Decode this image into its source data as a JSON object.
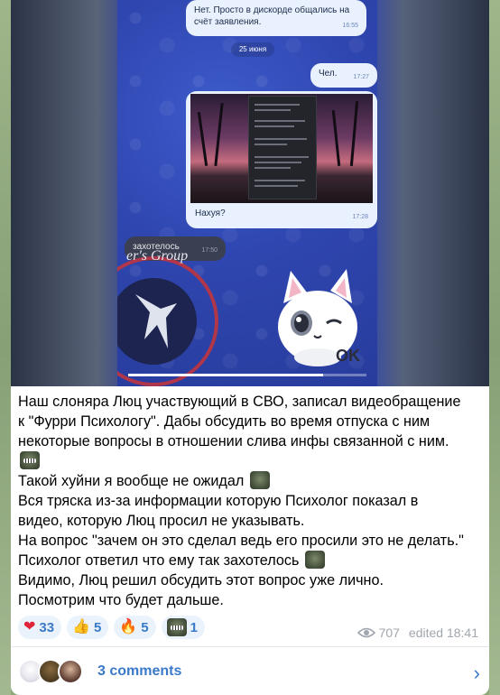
{
  "video": {
    "messages": {
      "msg1_text": "Нет. Просто в дискорде общались на счёт заявления.",
      "msg1_time": "16:55",
      "date": "25 июня",
      "msg2_text": "Чел.",
      "msg2_time": "17:27",
      "msg3_text": "Нахуя?",
      "msg3_time": "17:28",
      "msg4_text": "захотелось",
      "msg4_time": "17:50"
    },
    "emblem_text": "er's Group",
    "sticker_text": "OK",
    "progress": 0.82
  },
  "post": {
    "lines": [
      "Наш слоняра Люц участвующий в СВО, записал видеобращение",
      "к \"Фурри Психологу\".  Дабы обсудить во время отпуска с ним",
      "некоторые вопросы в отношении слива инфы связанной с ним.",
      "Такой хуйни я вообще не ожидал",
      "Вся тряска из-за информации которую Психолог показал в",
      "видео, которую Люц просил не указывать.",
      "На вопрос \"зачем он это сделал ведь его просили это не делать.\"",
      "Психолог ответил что ему так захотелось",
      "Видимо, Люц решил обсудить этот вопрос уже лично.",
      "Посмотрим что будет дальше."
    ]
  },
  "reactions": [
    {
      "icon": "heart-icon",
      "glyph": "❤",
      "color": "#e0243a",
      "count": "33"
    },
    {
      "icon": "thumbs-up-icon",
      "glyph": "👍",
      "color": "#f2b84b",
      "count": "5"
    },
    {
      "icon": "fire-icon",
      "glyph": "🔥",
      "color": "#f06a1c",
      "count": "5"
    },
    {
      "icon": "grimace-emoji-icon",
      "glyph": "",
      "color": "#4a5540",
      "count": "1"
    }
  ],
  "meta": {
    "views": "707",
    "edited": "edited 18:41"
  },
  "comments": {
    "label": "3 comments"
  }
}
